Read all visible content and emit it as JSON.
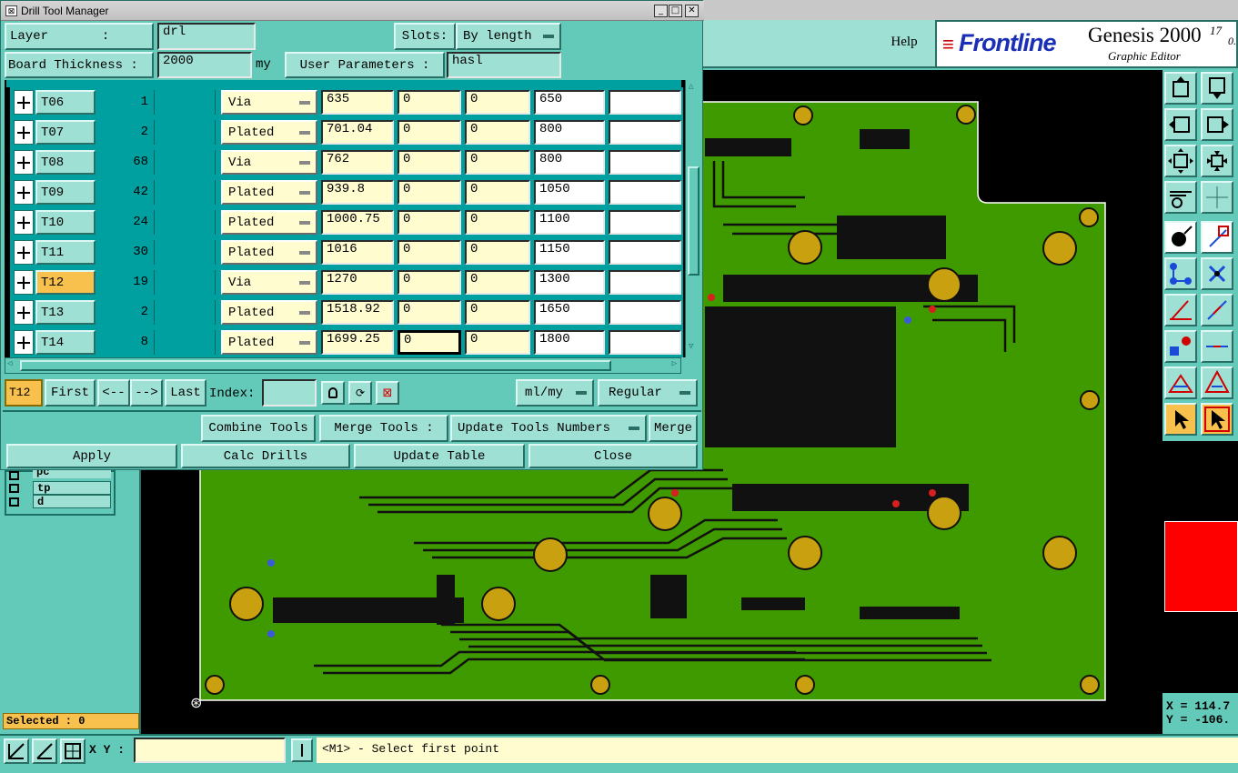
{
  "window": {
    "title": "Drill Tool Manager"
  },
  "header": {
    "layer_label": "Layer       :",
    "layer_value": "drl",
    "slots_label": "Slots:",
    "slots_value": "By length",
    "thickness_label": "Board Thickness :",
    "thickness_value": "2000",
    "thickness_unit": "my",
    "user_params_label": "User Parameters :",
    "user_params_value": "hasl"
  },
  "tools": [
    {
      "name": "T06",
      "count": "1",
      "type": "Via",
      "size": "635",
      "p1": "0",
      "p2": "0",
      "finish": "650",
      "extra": "",
      "selected": false
    },
    {
      "name": "T07",
      "count": "2",
      "type": "Plated",
      "size": "701.04",
      "p1": "0",
      "p2": "0",
      "finish": "800",
      "extra": "",
      "selected": false
    },
    {
      "name": "T08",
      "count": "68",
      "type": "Via",
      "size": "762",
      "p1": "0",
      "p2": "0",
      "finish": "800",
      "extra": "",
      "selected": false
    },
    {
      "name": "T09",
      "count": "42",
      "type": "Plated",
      "size": "939.8",
      "p1": "0",
      "p2": "0",
      "finish": "1050",
      "extra": "",
      "selected": false
    },
    {
      "name": "T10",
      "count": "24",
      "type": "Plated",
      "size": "1000.75",
      "p1": "0",
      "p2": "0",
      "finish": "1100",
      "extra": "",
      "selected": false
    },
    {
      "name": "T11",
      "count": "30",
      "type": "Plated",
      "size": "1016",
      "p1": "0",
      "p2": "0",
      "finish": "1150",
      "extra": "",
      "selected": false
    },
    {
      "name": "T12",
      "count": "19",
      "type": "Via",
      "size": "1270",
      "p1": "0",
      "p2": "0",
      "finish": "1300",
      "extra": "",
      "selected": true
    },
    {
      "name": "T13",
      "count": "2",
      "type": "Plated",
      "size": "1518.92",
      "p1": "0",
      "p2": "0",
      "finish": "1650",
      "extra": "",
      "selected": false
    },
    {
      "name": "T14",
      "count": "8",
      "type": "Plated",
      "size": "1699.25",
      "p1": "0",
      "p2": "0",
      "finish": "1800",
      "extra": "",
      "selected": false
    }
  ],
  "nav": {
    "current": "T12",
    "first": "First",
    "prev": "<--",
    "next": "-->",
    "last": "Last",
    "index_label": "Index:",
    "index_value": "",
    "units": "ml/my",
    "mode": "Regular"
  },
  "actions": {
    "combine": "Combine Tools",
    "merge_label": "Merge Tools :",
    "update_numbers": "Update Tools Numbers",
    "merge": "Merge",
    "apply": "Apply",
    "calc": "Calc Drills",
    "update_table": "Update Table",
    "close": "Close"
  },
  "app": {
    "help": "Help",
    "brand": "Frontline",
    "product": "Genesis 2000",
    "version": "17",
    "version2": "0.",
    "subtitle": "Graphic Editor"
  },
  "layers": [
    "pc",
    "tp",
    "d"
  ],
  "status": {
    "selected": "Selected : 0",
    "xy_label": "X Y :",
    "xy_value": "",
    "prompt": "<M1> - Select first point",
    "coord_x": "X = 114.7",
    "coord_y": "Y = -106."
  },
  "colors": {
    "board": "#3f9a00",
    "pad": "#c8a010",
    "selected_row": "#f8c04c",
    "field": "#fffcd0",
    "accent": "#ff0000"
  }
}
